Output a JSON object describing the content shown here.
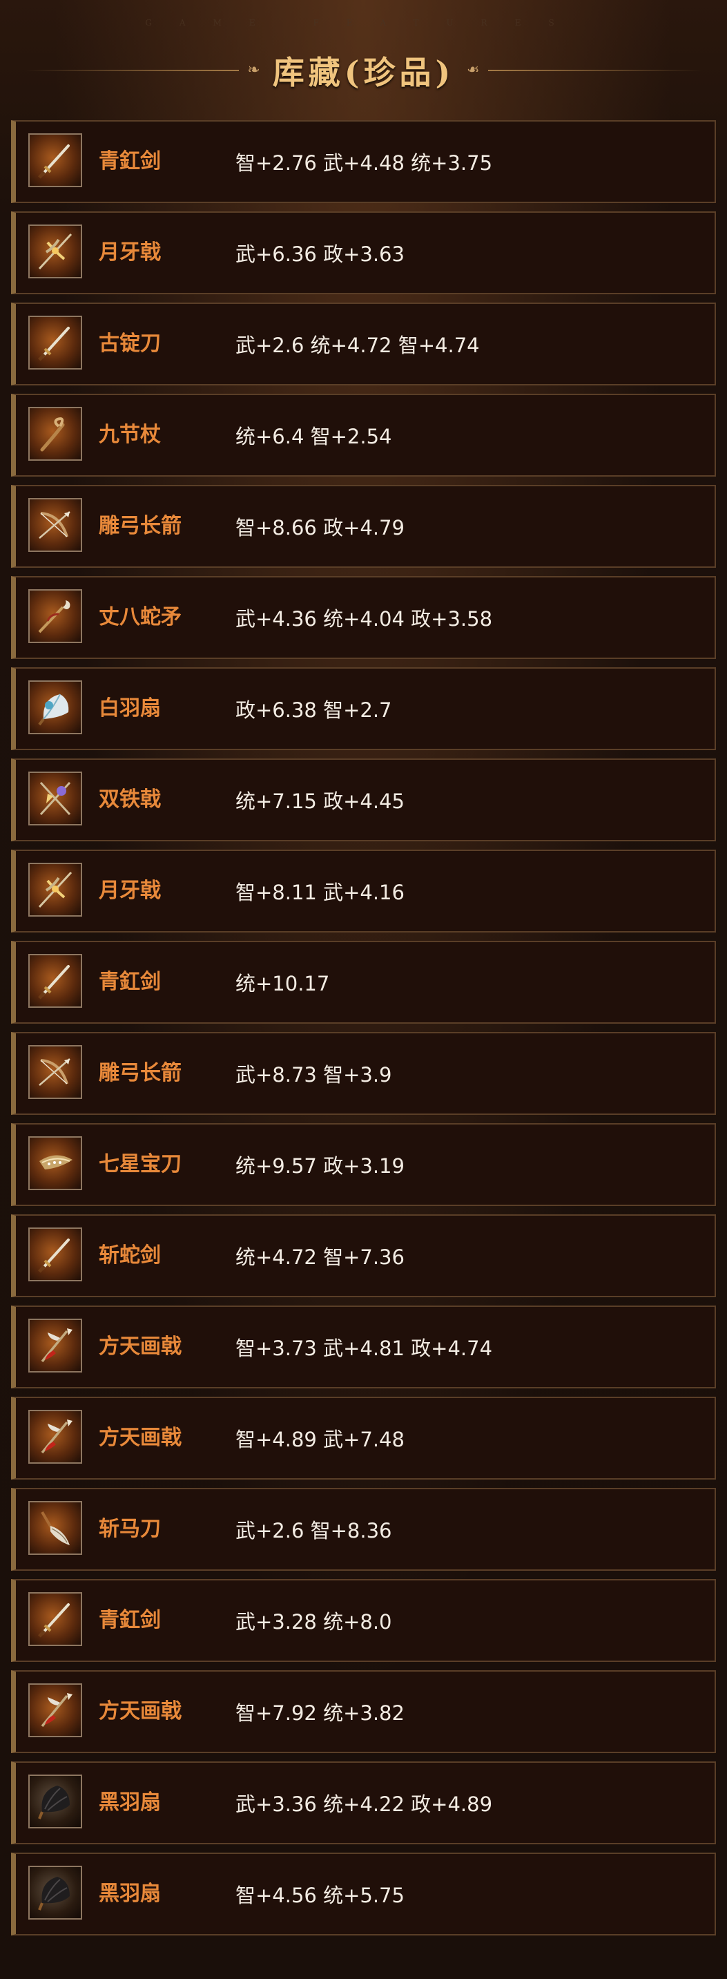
{
  "header": {
    "subtitle": "GAME FEATURES",
    "title": "库藏(珍品)"
  },
  "items": [
    {
      "name": "青釭剑",
      "stats": "智+2.76 武+4.48 统+3.75",
      "icon": "sword-icon"
    },
    {
      "name": "月牙戟",
      "stats": "武+6.36 政+3.63",
      "icon": "crescent-halberd-icon"
    },
    {
      "name": "古锭刀",
      "stats": "武+2.6 统+4.72 智+4.74",
      "icon": "sword-icon"
    },
    {
      "name": "九节杖",
      "stats": "统+6.4 智+2.54",
      "icon": "staff-icon"
    },
    {
      "name": "雕弓长箭",
      "stats": "智+8.66 政+4.79",
      "icon": "bow-icon"
    },
    {
      "name": "丈八蛇矛",
      "stats": "武+4.36 统+4.04 政+3.58",
      "icon": "serpent-spear-icon"
    },
    {
      "name": "白羽扇",
      "stats": "政+6.38 智+2.7",
      "icon": "white-fan-icon"
    },
    {
      "name": "双铁戟",
      "stats": "统+7.15 政+4.45",
      "icon": "double-halberd-icon"
    },
    {
      "name": "月牙戟",
      "stats": "智+8.11 武+4.16",
      "icon": "crescent-halberd-icon"
    },
    {
      "name": "青釭剑",
      "stats": "统+10.17",
      "icon": "sword-icon"
    },
    {
      "name": "雕弓长箭",
      "stats": "武+8.73 智+3.9",
      "icon": "bow-icon"
    },
    {
      "name": "七星宝刀",
      "stats": "统+9.57 政+3.19",
      "icon": "seven-star-blade-icon"
    },
    {
      "name": "斩蛇剑",
      "stats": "统+4.72 智+7.36",
      "icon": "sword-icon"
    },
    {
      "name": "方天画戟",
      "stats": "智+3.73 武+4.81 政+4.74",
      "icon": "sky-halberd-icon"
    },
    {
      "name": "方天画戟",
      "stats": "智+4.89 武+7.48",
      "icon": "sky-halberd-icon"
    },
    {
      "name": "斩马刀",
      "stats": "武+2.6 智+8.36",
      "icon": "horse-blade-icon"
    },
    {
      "name": "青釭剑",
      "stats": "武+3.28 统+8.0",
      "icon": "sword-icon"
    },
    {
      "name": "方天画戟",
      "stats": "智+7.92 统+3.82",
      "icon": "sky-halberd-icon"
    },
    {
      "name": "黑羽扇",
      "stats": "武+3.36 统+4.22 政+4.89",
      "icon": "black-fan-icon"
    },
    {
      "name": "黑羽扇",
      "stats": "智+4.56 统+5.75",
      "icon": "black-fan-icon"
    }
  ],
  "colors": {
    "item_name": "#e8893a",
    "stat_text": "#f3ece3",
    "title": "#f0c47e",
    "row_bg": "#200f09",
    "row_border": "#5a3e27"
  }
}
